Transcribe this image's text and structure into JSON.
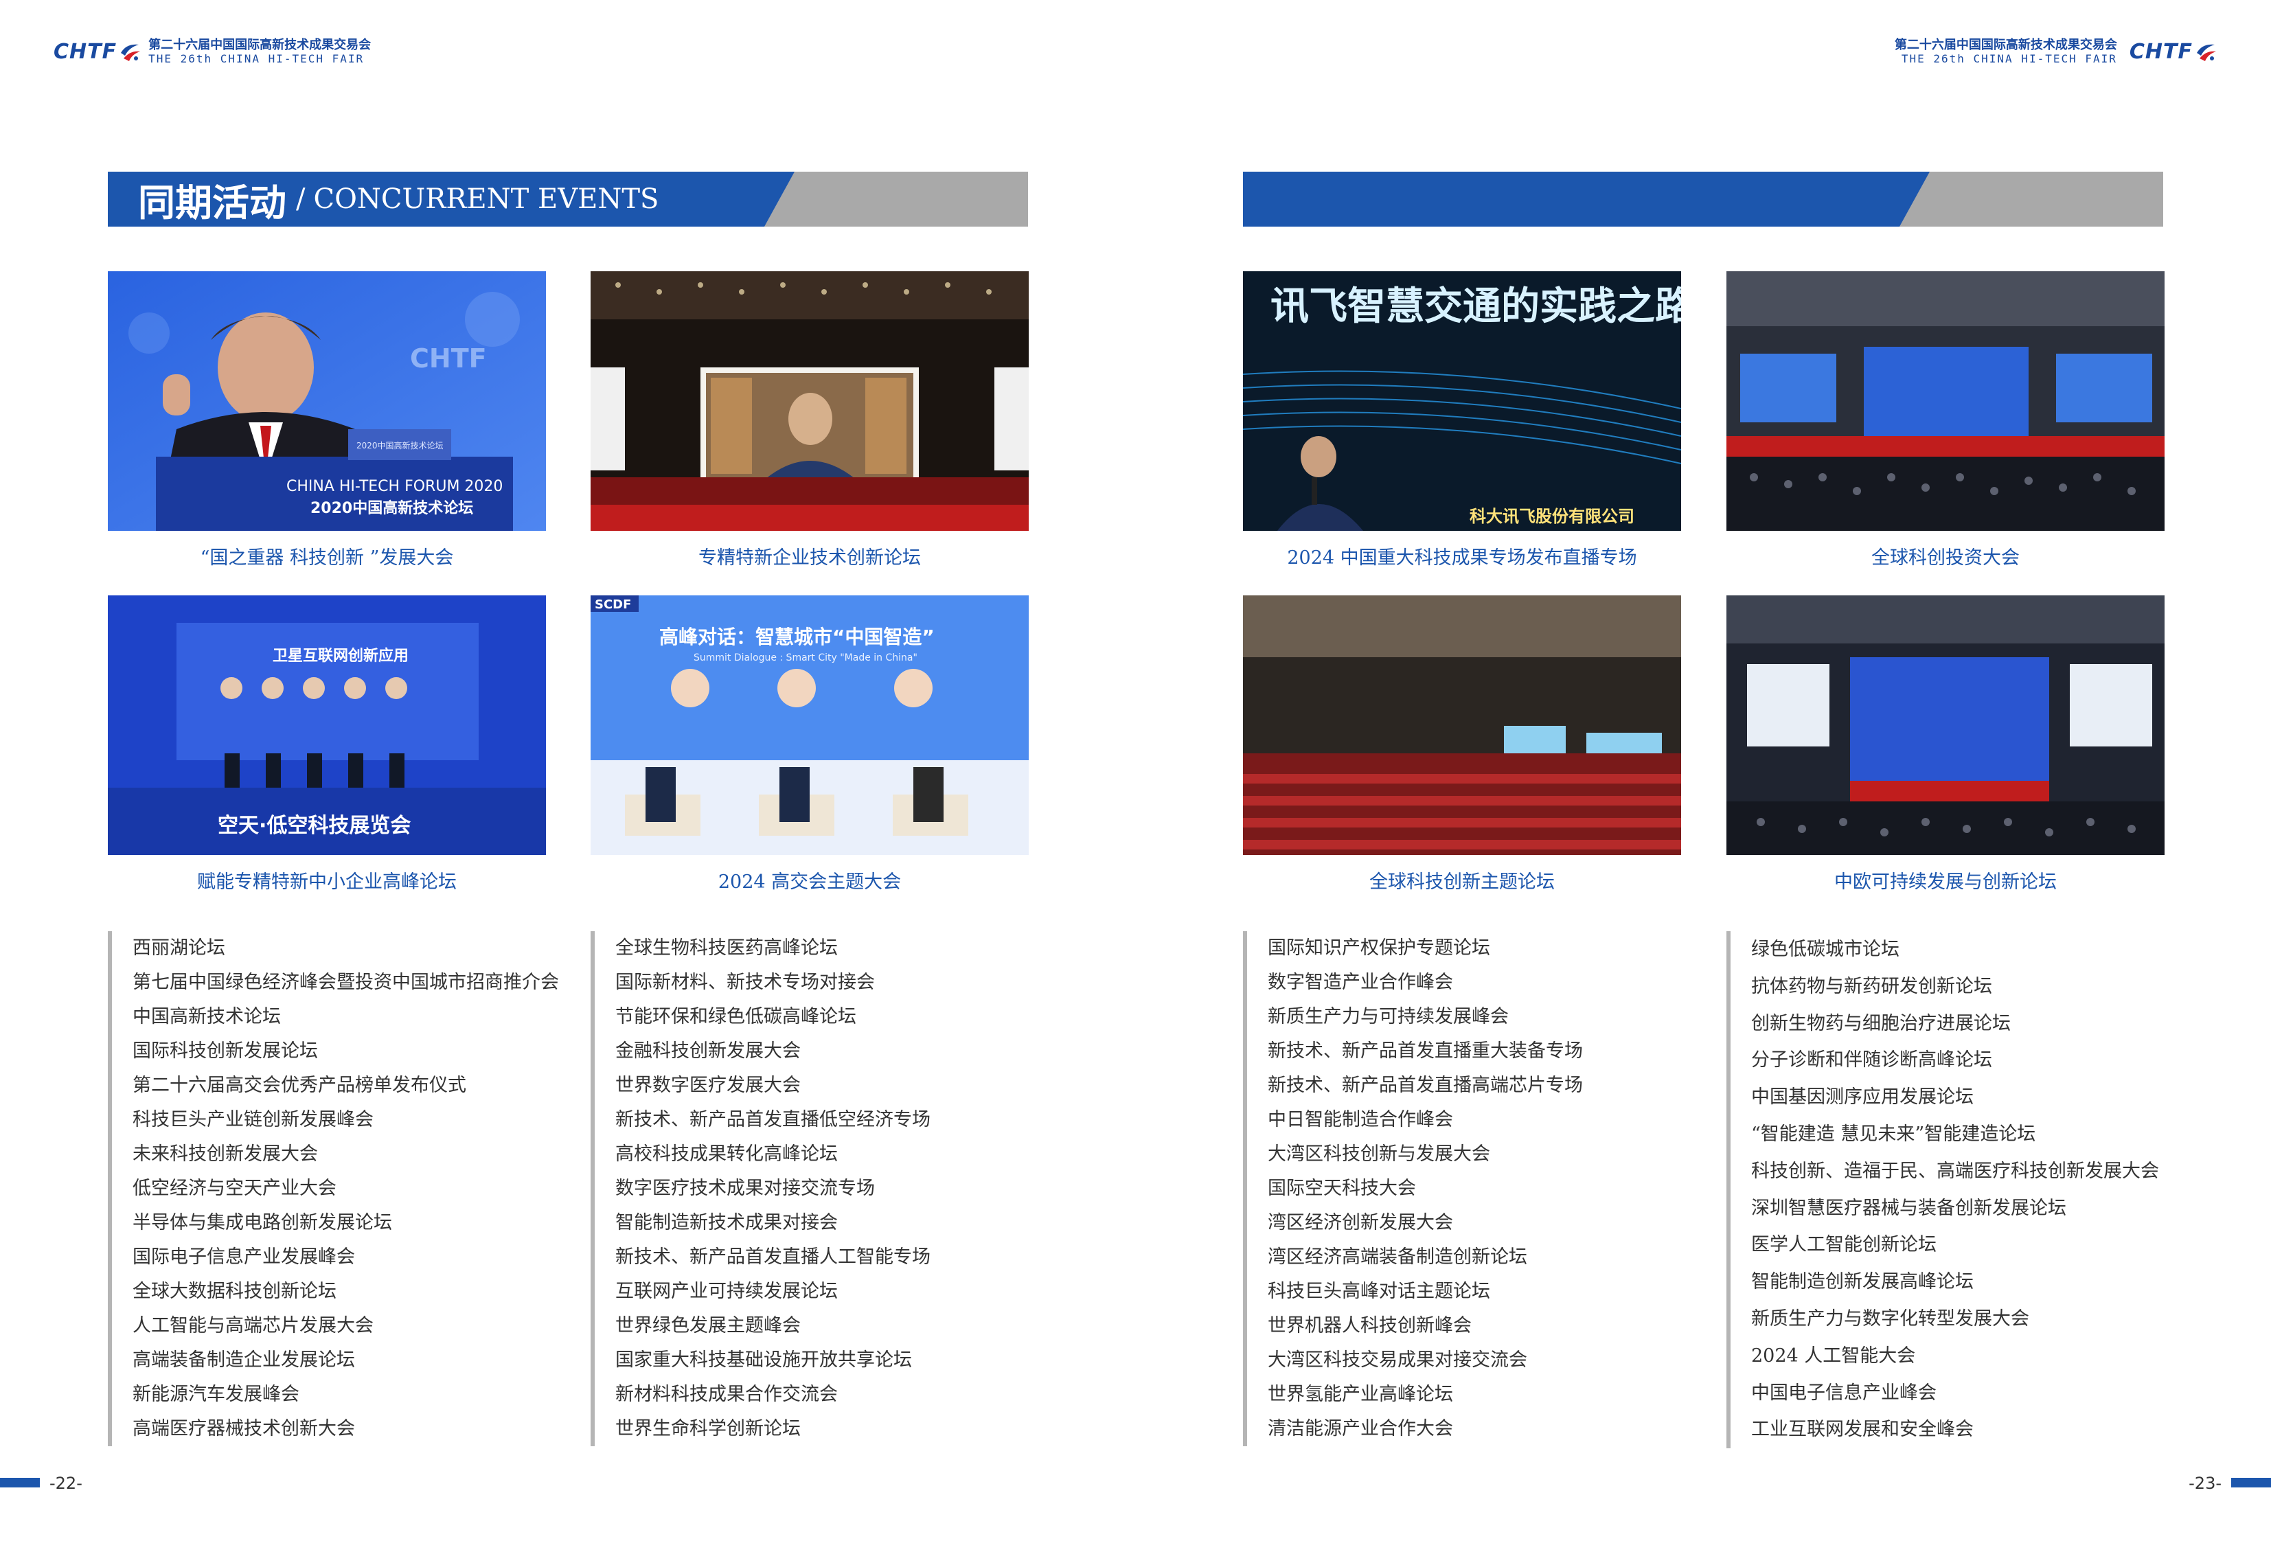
{
  "header": {
    "logo": "CHTF",
    "title_cn": "第二十六届中国国际高新技术成果交易会",
    "title_en": "THE 26th CHINA HI-TECH FAIR"
  },
  "banner": {
    "title_cn": "同期活动",
    "separator": "/",
    "title_en": "CONCURRENT EVENTS"
  },
  "photos": [
    {
      "caption": "“国之重器 科技创新 ”发展大会",
      "sign_line1": "CHINA HI-TECH FORUM 2020",
      "sign_line2": "2020中国高新技术论坛",
      "podium_label": "2020中国高新技术论坛",
      "backdrop_text": "CHTF"
    },
    {
      "caption": "专精特新企业技术创新论坛"
    },
    {
      "caption": "2024 中国重大科技成果专场发布直播专场",
      "screen_title": "讯飞智慧交通的实践之路",
      "company": "科大讯飞股份有限公司"
    },
    {
      "caption": "全球科创投资大会"
    },
    {
      "caption": "赋能专精特新中小企业高峰论坛",
      "screen_title": "卫星互联网创新应用",
      "stage_label": "空天·低空科技展览会"
    },
    {
      "caption": "2024 高交会主题大会",
      "logo": "SCDF",
      "screen_title": "高峰对话：智慧城市“中国智造”",
      "screen_subtitle": "Summit Dialogue : Smart City \"Made in China\""
    },
    {
      "caption": "全球科技创新主题论坛"
    },
    {
      "caption": "中欧可持续发展与创新论坛"
    }
  ],
  "lists": [
    [
      "西丽湖论坛",
      "第七届中国绿色经济峰会暨投资中国城市招商推介会",
      "中国高新技术论坛",
      "国际科技创新发展论坛",
      "第二十六届高交会优秀产品榜单发布仪式",
      "科技巨头产业链创新发展峰会",
      "未来科技创新发展大会",
      "低空经济与空天产业大会",
      "半导体与集成电路创新发展论坛",
      "国际电子信息产业发展峰会",
      "全球大数据科技创新论坛",
      "人工智能与高端芯片发展大会",
      "高端装备制造企业发展论坛",
      "新能源汽车发展峰会",
      "高端医疗器械技术创新大会"
    ],
    [
      "全球生物科技医药高峰论坛",
      "国际新材料、新技术专场对接会",
      "节能环保和绿色低碳高峰论坛",
      "金融科技创新发展大会",
      "世界数字医疗发展大会",
      "新技术、新产品首发直播低空经济专场",
      "高校科技成果转化高峰论坛",
      "数字医疗技术成果对接交流专场",
      "智能制造新技术成果对接会",
      "新技术、新产品首发直播人工智能专场",
      "互联网产业可持续发展论坛",
      "世界绿色发展主题峰会",
      "国家重大科技基础设施开放共享论坛",
      "新材料科技成果合作交流会",
      "世界生命科学创新论坛"
    ],
    [
      "国际知识产权保护专题论坛",
      "数字智造产业合作峰会",
      "新质生产力与可持续发展峰会",
      "新技术、新产品首发直播重大装备专场",
      "新技术、新产品首发直播高端芯片专场",
      "中日智能制造合作峰会",
      "大湾区科技创新与发展大会",
      "国际空天科技大会",
      "湾区经济创新发展大会",
      "湾区经济高端装备制造创新论坛",
      "科技巨头高峰对话主题论坛",
      "世界机器人科技创新峰会",
      "大湾区科技交易成果对接交流会",
      "世界氢能产业高峰论坛",
      "清洁能源产业合作大会"
    ],
    [
      "绿色低碳城市论坛",
      "抗体药物与新药研发创新论坛",
      "创新生物药与细胞治疗进展论坛",
      "分子诊断和伴随诊断高峰论坛",
      "中国基因测序应用发展论坛",
      "“智能建造 慧见未来”智能建造论坛",
      "科技创新、造福于民、高端医疗科技创新发展大会",
      "深圳智慧医疗器械与装备创新发展论坛",
      "医学人工智能创新论坛",
      "智能制造创新发展高峰论坛",
      "新质生产力与数字化转型发展大会",
      "2024 人工智能大会",
      "中国电子信息产业峰会",
      "工业互联网发展和安全峰会"
    ]
  ],
  "pages": {
    "left": "-22-",
    "right": "-23-"
  },
  "colors": {
    "brand_blue": "#1c56ad",
    "banner_gray": "#a9a9a9",
    "list_rule": "#b5b5b5"
  }
}
